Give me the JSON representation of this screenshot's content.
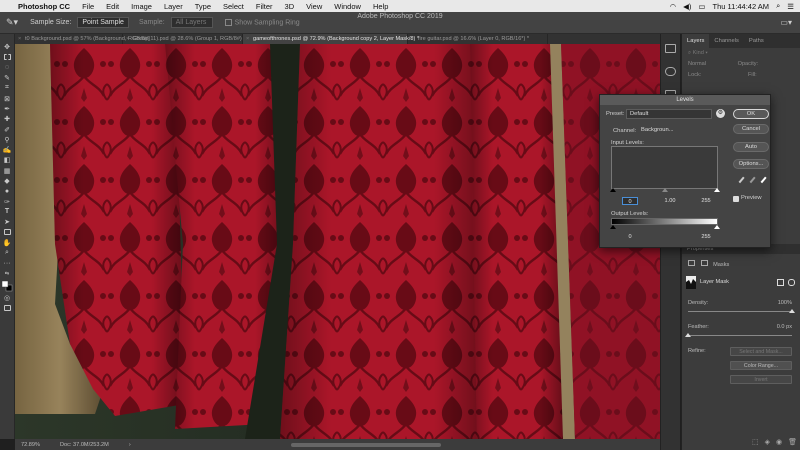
{
  "menubar": {
    "app": "Photoshop CC",
    "items": [
      "File",
      "Edit",
      "Image",
      "Layer",
      "Type",
      "Select",
      "Filter",
      "3D",
      "View",
      "Window",
      "Help"
    ],
    "clock": "Thu 11:44:42 AM"
  },
  "window_title": "Adobe Photoshop CC 2019",
  "options": {
    "sample_size_label": "Sample Size:",
    "sample_size_value": "Point Sample",
    "sample_label": "Sample:",
    "sample_value": "All Layers",
    "show_ring": "Show Sampling Ring"
  },
  "tabs": [
    {
      "label": "t0 Background.psd @ 57% (Background, RGB/8#)",
      "active": false
    },
    {
      "label": "Group(11).psd @ 28.6% (Group 1, RGB/8#)",
      "active": false
    },
    {
      "label": "gameofthrones.psd @ 72.9% (Background copy 2, Layer Mask/8) *",
      "active": true
    },
    {
      "label": "fire guitar.psd @ 16.6% (Layer 0, RGB/16*) *",
      "active": false
    }
  ],
  "status": {
    "zoom": "72.89%",
    "doc": "Doc: 37.0M/253.2M"
  },
  "panel_tabs": [
    "Layers",
    "Channels",
    "Paths"
  ],
  "layers_rows": [
    "Normal",
    "Lock:"
  ],
  "layers_fields": {
    "opacity": "Opacity:",
    "fill": "Fill:"
  },
  "properties": {
    "title": "Properties",
    "masks_label": "Masks",
    "layer_mask_label": "Layer Mask",
    "density_label": "Density:",
    "density_value": "100%",
    "feather_label": "Feather:",
    "feather_value": "0.0 px",
    "refine_label": "Refine:",
    "select_mask_btn": "Select and Mask...",
    "color_range_btn": "Color Range...",
    "invert_btn": "Invert"
  },
  "levels": {
    "title": "Levels",
    "preset_label": "Preset:",
    "preset_value": "Default",
    "channel_label": "Channel:",
    "channel_value": "Backgroun...",
    "input_label": "Input Levels:",
    "input_black": "0",
    "input_gamma": "1.00",
    "input_white": "255",
    "output_label": "Output Levels:",
    "output_black": "0",
    "output_white": "255",
    "buttons": {
      "ok": "OK",
      "cancel": "Cancel",
      "auto": "Auto",
      "options": "Options..."
    },
    "preview_label": "Preview",
    "preview_checked": true
  },
  "colors": {
    "fabric_red": "#b5182c",
    "fabric_dark": "#6e0c18",
    "gold": "#a08a60",
    "shadow_green": "#2f3a2c"
  }
}
